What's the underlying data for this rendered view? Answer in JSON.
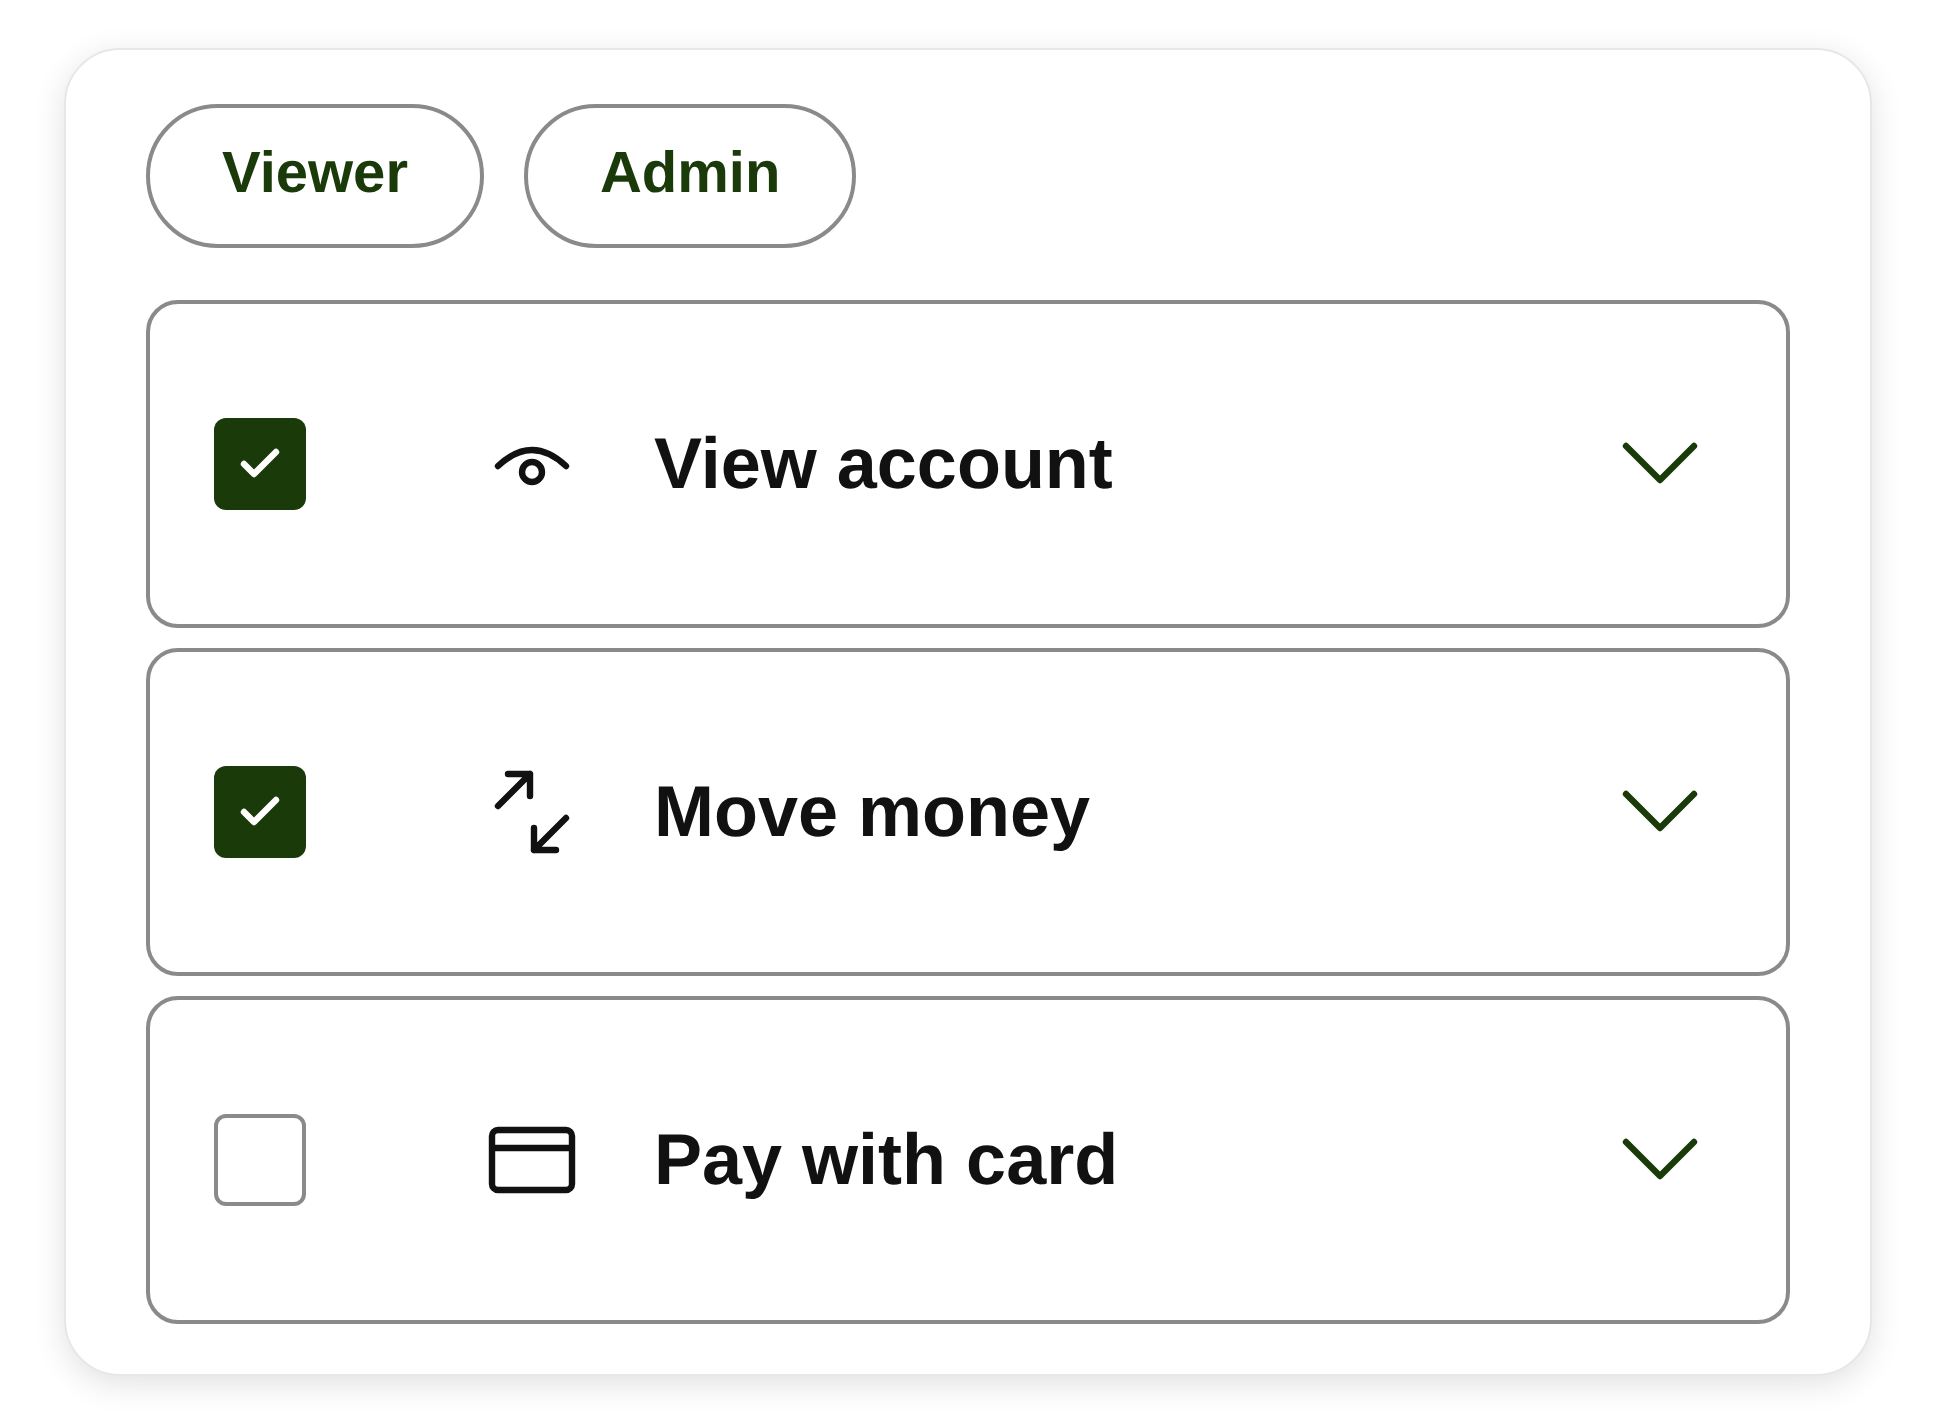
{
  "role_chips": [
    {
      "label": "Viewer"
    },
    {
      "label": "Admin"
    }
  ],
  "permissions": [
    {
      "label": "View account",
      "kind": "eye",
      "checked": true,
      "expanded": false
    },
    {
      "label": "Move money",
      "kind": "transfer",
      "checked": true,
      "expanded": false
    },
    {
      "label": "Pay with card",
      "kind": "card",
      "checked": false,
      "expanded": false
    }
  ]
}
